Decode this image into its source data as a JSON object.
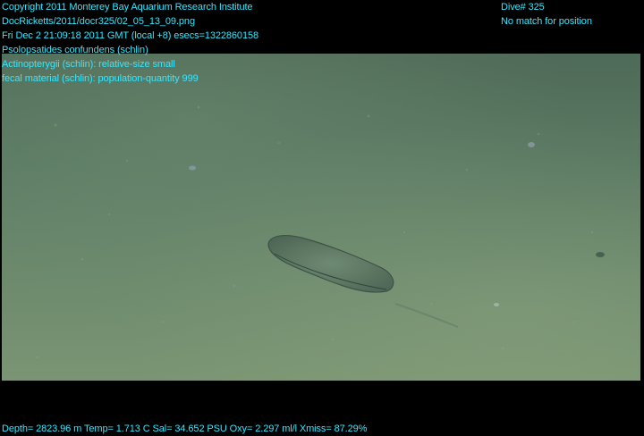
{
  "overlay": {
    "copyright": "Copyright 2011 Monterey Bay Aquarium Research Institute",
    "image_path": "DocRicketts/2011/docr325/02_05_13_09.png",
    "timestamp": "Fri Dec  2 21:09:18 2011 GMT (local +8)  esecs=1322860158",
    "annotation_1": "Psolopsatides confundens (schlin)",
    "annotation_2": "Actinopterygii (schlin): relative-size small",
    "annotation_3": "fecal material (schlin): population-quantity 999",
    "dive": "Dive# 325",
    "position": "No match for position",
    "sensors": "Depth= 2823.96 m  Temp= 1.713 C  Sal= 34.652 PSU  Oxy= 2.297 ml/l  Xmiss= 87.29%"
  },
  "colors": {
    "overlay_text": "#35e8ff",
    "background": "#000000"
  }
}
